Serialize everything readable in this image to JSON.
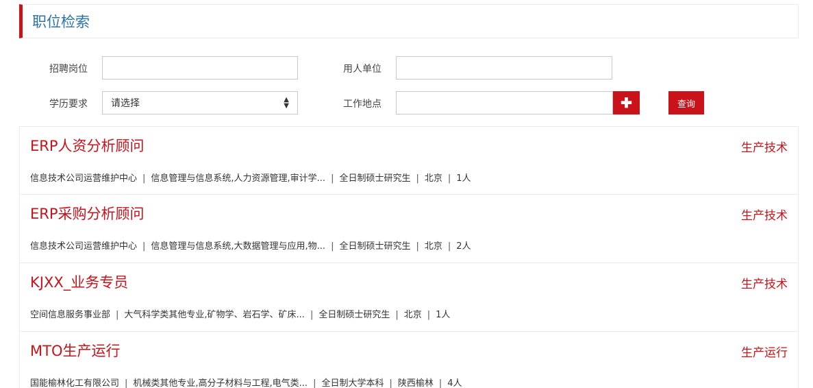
{
  "header": {
    "title": "职位检索"
  },
  "form": {
    "position_label": "招聘岗位",
    "position_value": "",
    "unit_label": "用人单位",
    "unit_value": "",
    "education_label": "学历要求",
    "education_selected": "请选择",
    "location_label": "工作地点",
    "location_value": "",
    "add_button_label": "✚",
    "query_button_label": "查询"
  },
  "jobs": [
    {
      "title": "ERP人资分析顾问",
      "category": "生产技术",
      "unit": "信息技术公司运营维护中心",
      "majors": "信息管理与信息系统,人力资源管理,审计学...",
      "education": "全日制硕士研究生",
      "location": "北京",
      "headcount": "1人"
    },
    {
      "title": "ERP采购分析顾问",
      "category": "生产技术",
      "unit": "信息技术公司运营维护中心",
      "majors": "信息管理与信息系统,大数据管理与应用,物...",
      "education": "全日制硕士研究生",
      "location": "北京",
      "headcount": "2人"
    },
    {
      "title": "KJXX_业务专员",
      "category": "生产技术",
      "unit": "空间信息服务事业部",
      "majors": "大气科学类其他专业,矿物学、岩石学、矿床...",
      "education": "全日制硕士研究生",
      "location": "北京",
      "headcount": "1人"
    },
    {
      "title": "MTO生产运行",
      "category": "生产运行",
      "unit": "国能榆林化工有限公司",
      "majors": "机械类其他专业,高分子材料与工程,电气类...",
      "education": "全日制大学本科",
      "location": "陕西榆林",
      "headcount": "4人"
    }
  ]
}
